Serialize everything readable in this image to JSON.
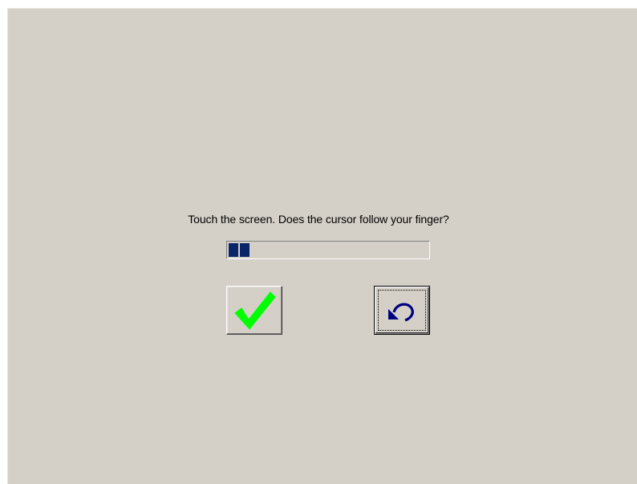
{
  "prompt": {
    "text": "Touch the screen. Does the cursor follow your finger?"
  },
  "progress": {
    "percent": 10,
    "color": "#0a246a"
  },
  "buttons": {
    "confirm": {
      "icon": "checkmark-icon",
      "icon_color": "#00ff00"
    },
    "retry": {
      "icon": "undo-arrow-icon",
      "icon_color": "#000080"
    }
  },
  "colors": {
    "background": "#d4d0c8"
  }
}
